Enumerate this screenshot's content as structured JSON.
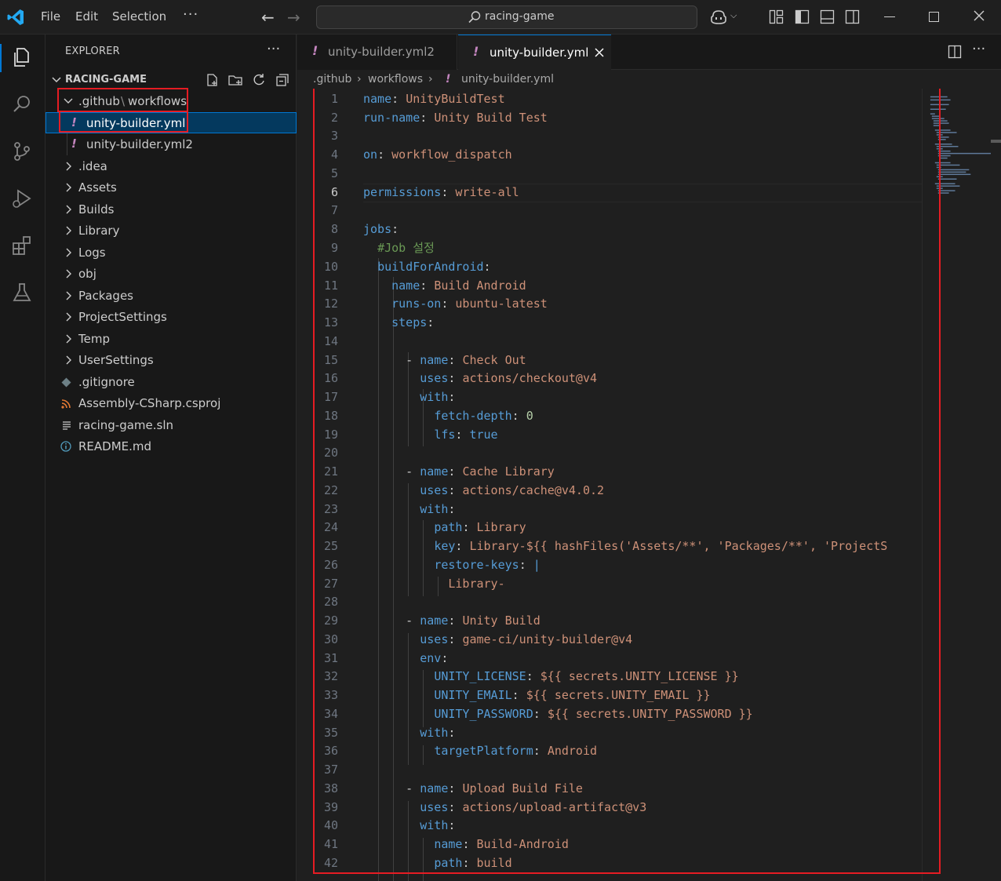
{
  "titlebar": {
    "menu": {
      "file": "File",
      "edit": "Edit",
      "selection": "Selection",
      "more": "···"
    },
    "search_text": "racing-game",
    "icons": [
      "vscode-logo-icon",
      "back-arrow-icon",
      "forward-arrow-icon",
      "search-icon",
      "copilot-icon",
      "customize-layout-icon",
      "toggle-sidebar-icon",
      "toggle-panel-icon",
      "toggle-secondary-sidebar-icon",
      "minimize-icon",
      "maximize-icon",
      "close-icon"
    ]
  },
  "activitybar": {
    "icons": [
      "explorer-icon",
      "search-icon",
      "source-control-icon",
      "run-debug-icon",
      "extensions-icon",
      "testing-icon"
    ]
  },
  "sidebar": {
    "title": "EXPLORER",
    "more": "···",
    "project": "RACING-GAME",
    "tree": {
      "github_folder": ".github",
      "workflows_folder": "workflows",
      "path_sep": "\\",
      "file_selected": "unity-builder.yml",
      "file_2": "unity-builder.yml2",
      "folders": [
        ".idea",
        "Assets",
        "Builds",
        "Library",
        "Logs",
        "obj",
        "Packages",
        "ProjectSettings",
        "Temp",
        "UserSettings"
      ],
      "files": [
        ".gitignore",
        "Assembly-CSharp.csproj",
        "racing-game.sln",
        "README.md"
      ]
    }
  },
  "tabs": {
    "tab1": "unity-builder.yml2",
    "tab2": "unity-builder.yml",
    "yaml_marker": "!"
  },
  "breadcrumb": {
    "seg1": ".github",
    "seg2": "workflows",
    "seg3": "unity-builder.yml"
  },
  "editor": {
    "active_line": 6,
    "line_numbers": [
      "1",
      "2",
      "3",
      "4",
      "5",
      "6",
      "7",
      "8",
      "9",
      "10",
      "11",
      "12",
      "13",
      "14",
      "15",
      "16",
      "17",
      "18",
      "19",
      "20",
      "21",
      "22",
      "23",
      "24",
      "25",
      "26",
      "27",
      "28",
      "29",
      "30",
      "31",
      "32",
      "33",
      "34",
      "35",
      "36",
      "37",
      "38",
      "39",
      "40",
      "41",
      "42"
    ],
    "code": {
      "l1k": "name",
      "l1v": "UnityBuildTest",
      "l2k": "run-name",
      "l2v": "Unity Build Test",
      "l4k": "on",
      "l4v": "workflow_dispatch",
      "l6k": "permissions",
      "l6v": "write-all",
      "l8k": "jobs",
      "l9c": "#Job 설정",
      "l10k": "buildForAndroid",
      "l11k": "name",
      "l11v": "Build Android",
      "l12k": "runs-on",
      "l12v": "ubuntu-latest",
      "l13k": "steps",
      "l15k": "name",
      "l15v": "Check Out",
      "l16k": "uses",
      "l16v": "actions/checkout@v4",
      "l17k": "with",
      "l18k": "fetch-depth",
      "l18v": "0",
      "l19k": "lfs",
      "l19v": "true",
      "l21k": "name",
      "l21v": "Cache Library",
      "l22k": "uses",
      "l22v": "actions/cache@v4.0.2",
      "l23k": "with",
      "l24k": "path",
      "l24v": "Library",
      "l25k": "key",
      "l25v": "Library-${{ hashFiles('Assets/**', 'Packages/**', 'ProjectS",
      "l26k": "restore-keys",
      "l26v": "|",
      "l27v": "Library-",
      "l29k": "name",
      "l29v": "Unity Build",
      "l30k": "uses",
      "l30v": "game-ci/unity-builder@v4",
      "l31k": "env",
      "l32k": "UNITY_LICENSE",
      "l32v": "${{ secrets.UNITY_LICENSE }}",
      "l33k": "UNITY_EMAIL",
      "l33v": "${{ secrets.UNITY_EMAIL }}",
      "l34k": "UNITY_PASSWORD",
      "l34v": "${{ secrets.UNITY_PASSWORD }}",
      "l35k": "with",
      "l36k": "targetPlatform",
      "l36v": "Android",
      "l38k": "name",
      "l38v": "Upload Build File",
      "l39k": "uses",
      "l39v": "actions/upload-artifact@v3",
      "l40k": "with",
      "l41k": "name",
      "l41v": "Build-Android",
      "l42k": "path",
      "l42v": "build"
    }
  },
  "colors": {
    "keyword": "#569cd6",
    "string": "#ce9178",
    "comment": "#6a9955",
    "number": "#b5cea8",
    "accent": "#0078d4",
    "highlight_box": "#e51c23"
  }
}
